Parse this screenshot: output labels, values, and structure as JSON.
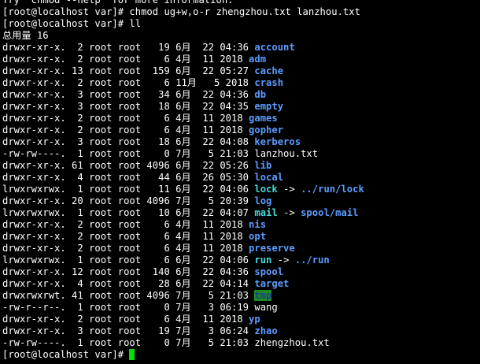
{
  "terminal": {
    "partial_top": "Try 'chmod --help' for more information.",
    "cmd1": "[root@localhost var]# chmod ug+w,o-r zhengzhou.txt lanzhou.txt",
    "cmd2": "[root@localhost var]# ll",
    "total": "总用量 16",
    "final_prompt": "[root@localhost var]# ",
    "colors": {
      "background": "#000000",
      "text": "#ffffff",
      "directory": "#5c9cff",
      "symlink": "#43d9d9",
      "sticky_bg": "#1f8a1f",
      "sticky_fg": "#1a3c9a",
      "cursor": "#00e000"
    }
  },
  "entries": [
    {
      "meta": "drwxr-xr-x.  2 root root   19 6月  22 04:36 ",
      "name": "account",
      "type": "dir"
    },
    {
      "meta": "drwxr-xr-x.  2 root root    6 4月  11 2018 ",
      "name": "adm",
      "type": "dir"
    },
    {
      "meta": "drwxr-xr-x. 13 root root  159 6月  22 05:27 ",
      "name": "cache",
      "type": "dir"
    },
    {
      "meta": "drwxr-xr-x.  2 root root    6 11月   5 2018 ",
      "name": "crash",
      "type": "dir"
    },
    {
      "meta": "drwxr-xr-x.  3 root root   34 6月  22 04:36 ",
      "name": "db",
      "type": "dir"
    },
    {
      "meta": "drwxr-xr-x.  3 root root   18 6月  22 04:35 ",
      "name": "empty",
      "type": "dir"
    },
    {
      "meta": "drwxr-xr-x.  2 root root    6 4月  11 2018 ",
      "name": "games",
      "type": "dir"
    },
    {
      "meta": "drwxr-xr-x.  2 root root    6 4月  11 2018 ",
      "name": "gopher",
      "type": "dir"
    },
    {
      "meta": "drwxr-xr-x.  3 root root   18 6月  22 04:08 ",
      "name": "kerberos",
      "type": "dir"
    },
    {
      "meta": "-rw-rw----.  1 root root    0 7月   5 21:03 ",
      "name": "lanzhou.txt",
      "type": "file"
    },
    {
      "meta": "drwxr-xr-x. 61 root root 4096 6月  22 05:26 ",
      "name": "lib",
      "type": "dir"
    },
    {
      "meta": "drwxr-xr-x.  4 root root   44 6月  26 05:30 ",
      "name": "local",
      "type": "dir"
    },
    {
      "meta": "lrwxrwxrwx.  1 root root   11 6月  22 04:06 ",
      "name": "lock",
      "type": "link",
      "arrow": " -> ",
      "target": "../run/lock"
    },
    {
      "meta": "drwxr-xr-x. 20 root root 4096 7月   5 20:39 ",
      "name": "log",
      "type": "dir"
    },
    {
      "meta": "lrwxrwxrwx.  1 root root   10 6月  22 04:07 ",
      "name": "mail",
      "type": "link",
      "arrow": " -> ",
      "target": "spool/mail"
    },
    {
      "meta": "drwxr-xr-x.  2 root root    6 4月  11 2018 ",
      "name": "nis",
      "type": "dir"
    },
    {
      "meta": "drwxr-xr-x.  2 root root    6 4月  11 2018 ",
      "name": "opt",
      "type": "dir"
    },
    {
      "meta": "drwxr-xr-x.  2 root root    6 4月  11 2018 ",
      "name": "preserve",
      "type": "dir"
    },
    {
      "meta": "lrwxrwxrwx.  1 root root    6 6月  22 04:06 ",
      "name": "run",
      "type": "link",
      "arrow": " -> ",
      "target": "../run"
    },
    {
      "meta": "drwxr-xr-x. 12 root root  140 6月  22 04:36 ",
      "name": "spool",
      "type": "dir"
    },
    {
      "meta": "drwxr-xr-x.  4 root root   28 6月  22 04:14 ",
      "name": "target",
      "type": "dir"
    },
    {
      "meta": "drwxrwxrwt. 41 root root 4096 7月   5 21:03 ",
      "name": "tmp",
      "type": "sticky"
    },
    {
      "meta": "-rw-r--r--.  1 root root    0 7月   3 06:19 ",
      "name": "wang",
      "type": "file"
    },
    {
      "meta": "drwxr-xr-x.  2 root root    6 4月  11 2018 ",
      "name": "yp",
      "type": "dir"
    },
    {
      "meta": "drwxr-xr-x.  3 root root   19 7月   3 06:24 ",
      "name": "zhao",
      "type": "dir"
    },
    {
      "meta": "-rw-rw----.  1 root root    0 7月   5 21:03 ",
      "name": "zhengzhou.txt",
      "type": "file"
    }
  ]
}
